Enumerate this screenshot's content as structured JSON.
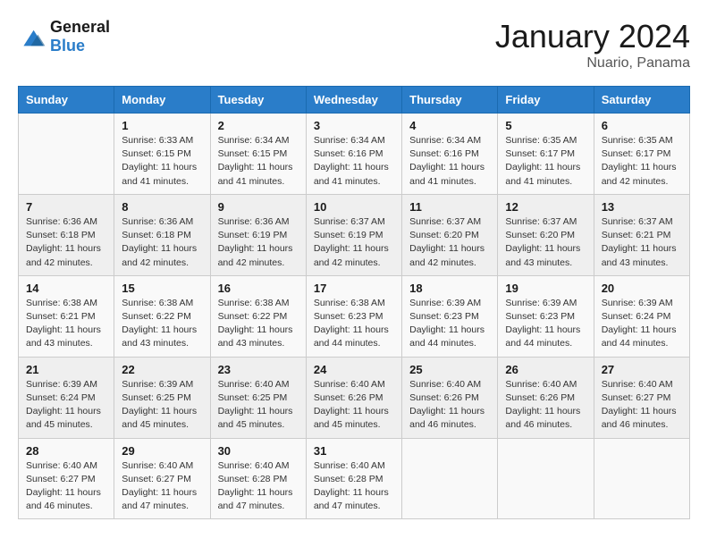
{
  "logo": {
    "line1": "General",
    "line2": "Blue"
  },
  "title": "January 2024",
  "location": "Nuario, Panama",
  "days_of_week": [
    "Sunday",
    "Monday",
    "Tuesday",
    "Wednesday",
    "Thursday",
    "Friday",
    "Saturday"
  ],
  "weeks": [
    [
      {
        "day": "",
        "info": ""
      },
      {
        "day": "1",
        "info": "Sunrise: 6:33 AM\nSunset: 6:15 PM\nDaylight: 11 hours and 41 minutes."
      },
      {
        "day": "2",
        "info": "Sunrise: 6:34 AM\nSunset: 6:15 PM\nDaylight: 11 hours and 41 minutes."
      },
      {
        "day": "3",
        "info": "Sunrise: 6:34 AM\nSunset: 6:16 PM\nDaylight: 11 hours and 41 minutes."
      },
      {
        "day": "4",
        "info": "Sunrise: 6:34 AM\nSunset: 6:16 PM\nDaylight: 11 hours and 41 minutes."
      },
      {
        "day": "5",
        "info": "Sunrise: 6:35 AM\nSunset: 6:17 PM\nDaylight: 11 hours and 41 minutes."
      },
      {
        "day": "6",
        "info": "Sunrise: 6:35 AM\nSunset: 6:17 PM\nDaylight: 11 hours and 42 minutes."
      }
    ],
    [
      {
        "day": "7",
        "info": "Sunrise: 6:36 AM\nSunset: 6:18 PM\nDaylight: 11 hours and 42 minutes."
      },
      {
        "day": "8",
        "info": "Sunrise: 6:36 AM\nSunset: 6:18 PM\nDaylight: 11 hours and 42 minutes."
      },
      {
        "day": "9",
        "info": "Sunrise: 6:36 AM\nSunset: 6:19 PM\nDaylight: 11 hours and 42 minutes."
      },
      {
        "day": "10",
        "info": "Sunrise: 6:37 AM\nSunset: 6:19 PM\nDaylight: 11 hours and 42 minutes."
      },
      {
        "day": "11",
        "info": "Sunrise: 6:37 AM\nSunset: 6:20 PM\nDaylight: 11 hours and 42 minutes."
      },
      {
        "day": "12",
        "info": "Sunrise: 6:37 AM\nSunset: 6:20 PM\nDaylight: 11 hours and 43 minutes."
      },
      {
        "day": "13",
        "info": "Sunrise: 6:37 AM\nSunset: 6:21 PM\nDaylight: 11 hours and 43 minutes."
      }
    ],
    [
      {
        "day": "14",
        "info": "Sunrise: 6:38 AM\nSunset: 6:21 PM\nDaylight: 11 hours and 43 minutes."
      },
      {
        "day": "15",
        "info": "Sunrise: 6:38 AM\nSunset: 6:22 PM\nDaylight: 11 hours and 43 minutes."
      },
      {
        "day": "16",
        "info": "Sunrise: 6:38 AM\nSunset: 6:22 PM\nDaylight: 11 hours and 43 minutes."
      },
      {
        "day": "17",
        "info": "Sunrise: 6:38 AM\nSunset: 6:23 PM\nDaylight: 11 hours and 44 minutes."
      },
      {
        "day": "18",
        "info": "Sunrise: 6:39 AM\nSunset: 6:23 PM\nDaylight: 11 hours and 44 minutes."
      },
      {
        "day": "19",
        "info": "Sunrise: 6:39 AM\nSunset: 6:23 PM\nDaylight: 11 hours and 44 minutes."
      },
      {
        "day": "20",
        "info": "Sunrise: 6:39 AM\nSunset: 6:24 PM\nDaylight: 11 hours and 44 minutes."
      }
    ],
    [
      {
        "day": "21",
        "info": "Sunrise: 6:39 AM\nSunset: 6:24 PM\nDaylight: 11 hours and 45 minutes."
      },
      {
        "day": "22",
        "info": "Sunrise: 6:39 AM\nSunset: 6:25 PM\nDaylight: 11 hours and 45 minutes."
      },
      {
        "day": "23",
        "info": "Sunrise: 6:40 AM\nSunset: 6:25 PM\nDaylight: 11 hours and 45 minutes."
      },
      {
        "day": "24",
        "info": "Sunrise: 6:40 AM\nSunset: 6:26 PM\nDaylight: 11 hours and 45 minutes."
      },
      {
        "day": "25",
        "info": "Sunrise: 6:40 AM\nSunset: 6:26 PM\nDaylight: 11 hours and 46 minutes."
      },
      {
        "day": "26",
        "info": "Sunrise: 6:40 AM\nSunset: 6:26 PM\nDaylight: 11 hours and 46 minutes."
      },
      {
        "day": "27",
        "info": "Sunrise: 6:40 AM\nSunset: 6:27 PM\nDaylight: 11 hours and 46 minutes."
      }
    ],
    [
      {
        "day": "28",
        "info": "Sunrise: 6:40 AM\nSunset: 6:27 PM\nDaylight: 11 hours and 46 minutes."
      },
      {
        "day": "29",
        "info": "Sunrise: 6:40 AM\nSunset: 6:27 PM\nDaylight: 11 hours and 47 minutes."
      },
      {
        "day": "30",
        "info": "Sunrise: 6:40 AM\nSunset: 6:28 PM\nDaylight: 11 hours and 47 minutes."
      },
      {
        "day": "31",
        "info": "Sunrise: 6:40 AM\nSunset: 6:28 PM\nDaylight: 11 hours and 47 minutes."
      },
      {
        "day": "",
        "info": ""
      },
      {
        "day": "",
        "info": ""
      },
      {
        "day": "",
        "info": ""
      }
    ]
  ]
}
